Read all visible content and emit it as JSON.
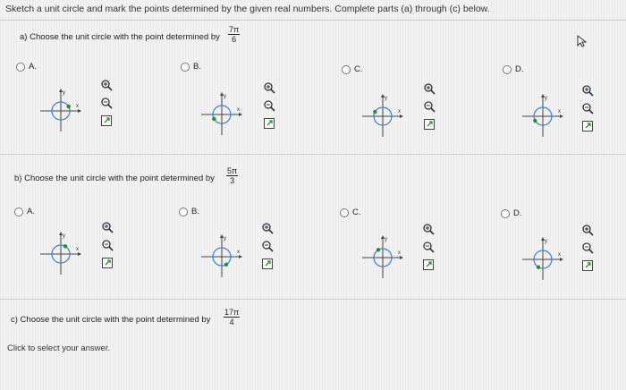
{
  "instruction": "Sketch a unit circle and mark the points determined by the given real numbers. Complete parts (a) through (c) below.",
  "parts": [
    {
      "label": "a) Choose the unit circle with the point determined by",
      "numerator": "7π",
      "denominator": "6",
      "options": [
        "A.",
        "B.",
        "C.",
        "D."
      ]
    },
    {
      "label": "b) Choose the unit circle with the point determined by",
      "numerator": "5π",
      "denominator": "3",
      "options": [
        "A.",
        "B.",
        "C.",
        "D."
      ]
    },
    {
      "label": "c) Choose the unit circle with the point determined by",
      "numerator": "17π",
      "denominator": "4"
    }
  ],
  "axis": {
    "x": "x",
    "y": "y"
  },
  "icons": [
    "zoom-in-icon",
    "zoom-out-icon",
    "expand-icon"
  ],
  "footer": "Click to select your answer."
}
